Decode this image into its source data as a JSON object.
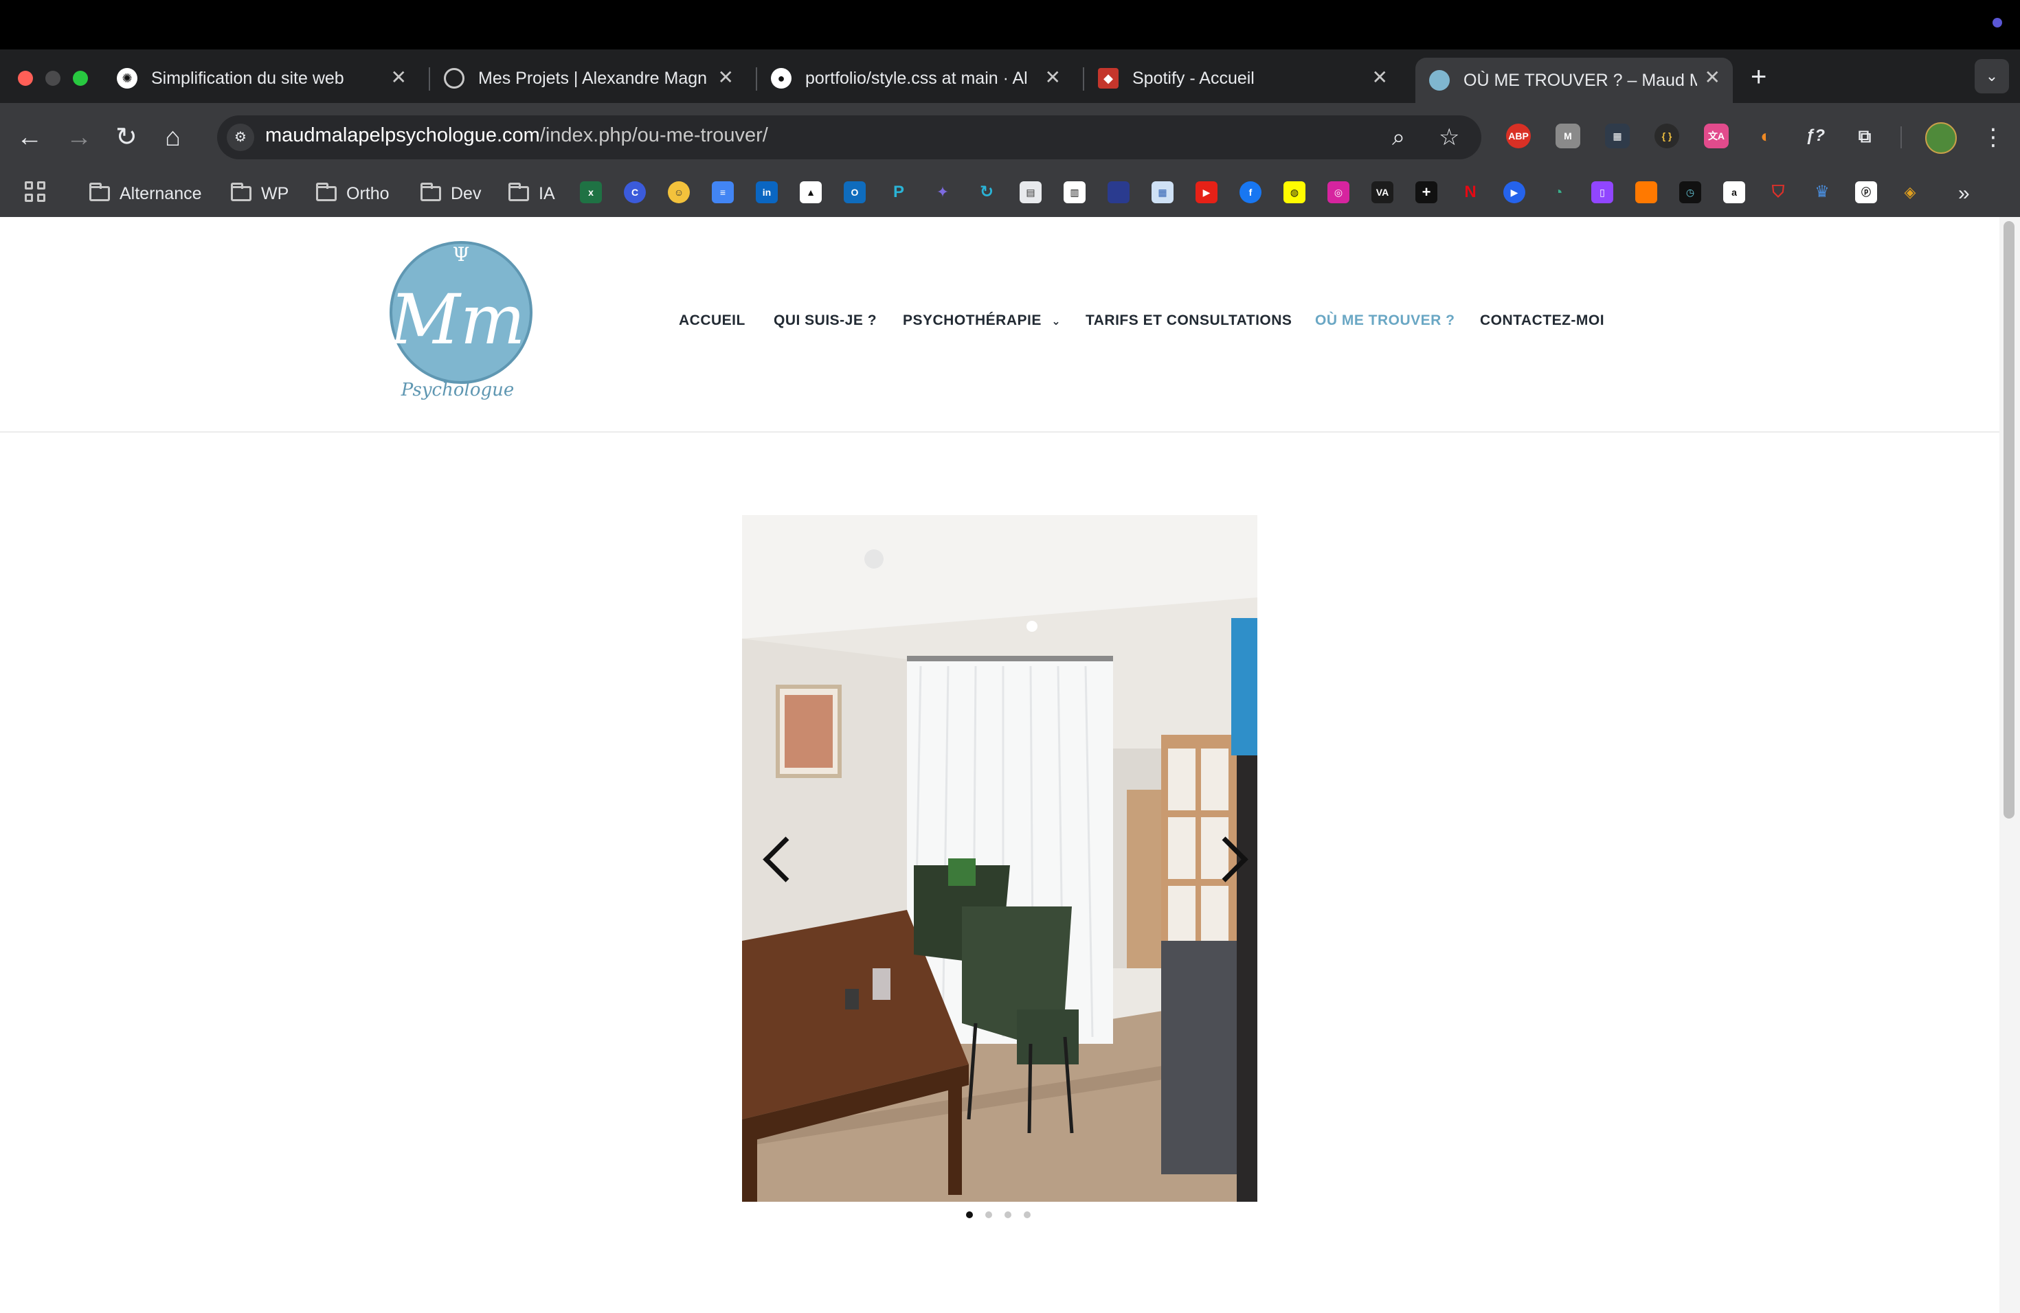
{
  "browser": {
    "tabs": [
      {
        "title": "Simplification du site web",
        "active": false,
        "icon": "openai-icon"
      },
      {
        "title": "Mes Projets | Alexandre Magn",
        "active": false,
        "icon": "globe-icon"
      },
      {
        "title": "portfolio/style.css at main · Al",
        "active": false,
        "icon": "github-icon"
      },
      {
        "title": "Spotify - Accueil",
        "active": false,
        "icon": "spotify-icon"
      },
      {
        "title": "OÙ ME TROUVER ? – Maud M",
        "active": true,
        "icon": "site-logo-icon"
      }
    ],
    "url": {
      "domain": "maudmalapelpsychologue.com",
      "path": "/index.php/ou-me-trouver/"
    },
    "extensions": [
      "ABP",
      "M",
      "{ }",
      "文A",
      "ƒ?"
    ],
    "bookmark_folders": [
      "Alternance",
      "WP",
      "Ortho",
      "Dev",
      "IA"
    ],
    "bookmark_icons": [
      "excel-icon",
      "c-icon",
      "emoji-icon",
      "docs-icon",
      "linkedin-icon",
      "school-icon",
      "outlook-icon",
      "p-icon",
      "star-icon",
      "refresh-icon",
      "calendar-icon",
      "grid-icon",
      "blank-icon",
      "board-icon",
      "youtube-icon",
      "facebook-icon",
      "snapchat-icon",
      "instagram-icon",
      "va-icon",
      "plus-icon",
      "netflix-icon",
      "play-icon",
      "chart-icon",
      "twitch-icon",
      "orange-icon",
      "clock-icon",
      "amazon-icon",
      "shield-icon",
      "crown-icon",
      "playstation-icon",
      "badge-icon"
    ],
    "bookmark_labels": {
      "linkedin": "in",
      "amazon": "a",
      "va": "VA",
      "plus": "+",
      "netflix": "N"
    }
  },
  "site": {
    "logo": {
      "initials": "Mm",
      "symbol": "Ψ",
      "tagline": "Psychologue",
      "color": "#7fb6cf"
    },
    "nav": [
      {
        "label": "ACCUEIL",
        "active": false
      },
      {
        "label": "QUI SUIS-JE ?",
        "active": false
      },
      {
        "label": "PSYCHOTHÉRAPIE",
        "active": false,
        "has_dropdown": true
      },
      {
        "label": "TARIFS ET CONSULTATIONS",
        "active": false
      },
      {
        "label": "OÙ ME TROUVER ?",
        "active": true
      },
      {
        "label": "CONTACTEZ-MOI",
        "active": false
      }
    ],
    "accent_color": "#6aa7c4",
    "slider": {
      "total_slides": 4,
      "current": 1,
      "image_desc": "consulting room with wooden desk, two green armchairs and shelves"
    }
  }
}
